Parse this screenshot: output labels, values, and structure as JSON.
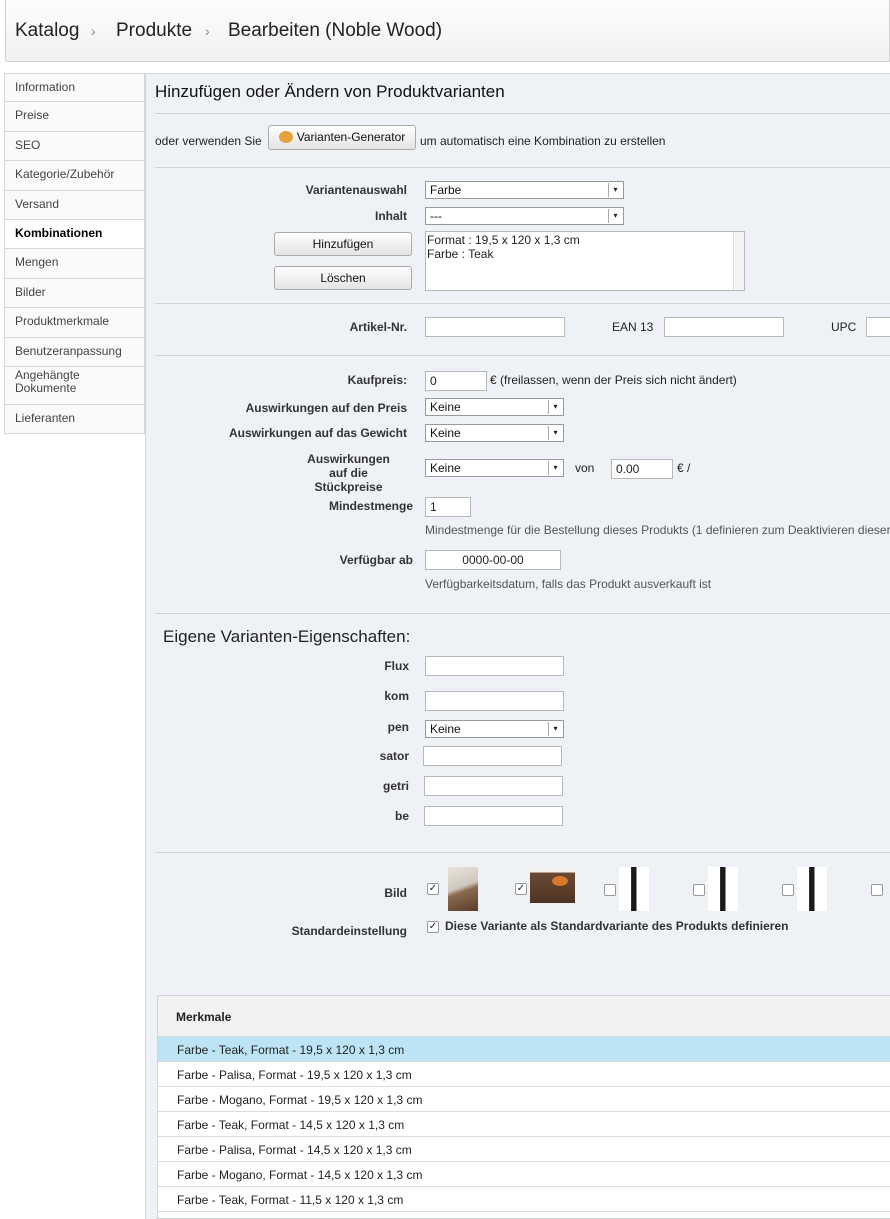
{
  "breadcrumb": {
    "items": [
      "Katalog",
      "Produkte",
      "Bearbeiten (Noble Wood)"
    ],
    "sep": "›"
  },
  "sidebar": {
    "items": [
      {
        "label": "Information"
      },
      {
        "label": "Preise"
      },
      {
        "label": "SEO"
      },
      {
        "label": "Kategorie/Zubehör"
      },
      {
        "label": "Versand"
      },
      {
        "label": "Kombinationen",
        "active": true
      },
      {
        "label": "Mengen"
      },
      {
        "label": "Bilder"
      },
      {
        "label": "Produktmerkmale"
      },
      {
        "label": "Benutzeranpassung"
      },
      {
        "label": "Angehängte Dokumente"
      },
      {
        "label": "Lieferanten"
      }
    ]
  },
  "main": {
    "title": "Hinzufügen oder Ändern von Produktvarianten",
    "gen_prefix": "oder verwenden Sie",
    "gen_button": "Varianten-Generator",
    "gen_suffix": "um automatisch eine Kombination zu erstellen",
    "attr_label": "Variantenauswahl",
    "attr_value": "Farbe",
    "content_label": "Inhalt",
    "content_value": "---",
    "add_button": "Hinzufügen",
    "delete_button": "Löschen",
    "list_line1": "Format : 19,5 x 120 x 1,3 cm",
    "list_line2": "Farbe : Teak",
    "ref_label": "Artikel-Nr.",
    "ean_label": "EAN 13",
    "upc_label": "UPC",
    "wholesale_label": "Kaufpreis:",
    "wholesale_value": "0",
    "wholesale_hint": "€ (freilassen, wenn der Preis sich nicht ändert)",
    "price_impact_label": "Auswirkungen auf den Preis",
    "price_impact_value": "Keine",
    "weight_impact_label": "Auswirkungen auf das Gewicht",
    "weight_impact_value": "Keine",
    "unit_impact_l1": "Auswirkungen",
    "unit_impact_l2": "auf die",
    "unit_impact_l3": "Stückpreise",
    "unit_impact_value": "Keine",
    "von": "von",
    "unit_value": "0.00",
    "unit_suffix": "€ /",
    "minqty_label": "Mindestmenge",
    "minqty_value": "1",
    "minqty_hint": "Mindestmenge für die Bestellung dieses Produkts (1 definieren zum Deaktivieren dieser",
    "avail_label": "Verfügbar ab",
    "avail_value": "0000-00-00",
    "avail_hint": "Verfügbarkeitsdatum, falls das Produkt ausverkauft ist",
    "custom_title": "Eigene Varianten-Eigenschaften:",
    "custom": {
      "flux": "Flux",
      "kom": "kom",
      "pen": "pen",
      "pen_value": "Keine",
      "sator": "sator",
      "getri": "getri",
      "be": "be"
    },
    "image_label": "Bild",
    "default_label": "Standardeinstellung",
    "default_text": "Diese Variante als Standardvariante des Produkts definieren",
    "table_header": "Merkmale",
    "rows": [
      "Farbe - Teak, Format - 19,5 x 120 x 1,3 cm",
      "Farbe - Palisa, Format - 19,5 x 120 x 1,3 cm",
      "Farbe - Mogano, Format - 19,5 x 120 x 1,3 cm",
      "Farbe - Teak, Format - 14,5 x 120 x 1,3 cm",
      "Farbe - Palisa, Format - 14,5 x 120 x 1,3 cm",
      "Farbe - Mogano, Format - 14,5 x 120 x 1,3 cm",
      "Farbe - Teak, Format - 11,5 x 120 x 1,3 cm"
    ],
    "check_mark": "✓",
    "arrow": "▾",
    "colors": {
      "selected_row": "#bde4f4",
      "panel": "#eef1f5"
    }
  }
}
